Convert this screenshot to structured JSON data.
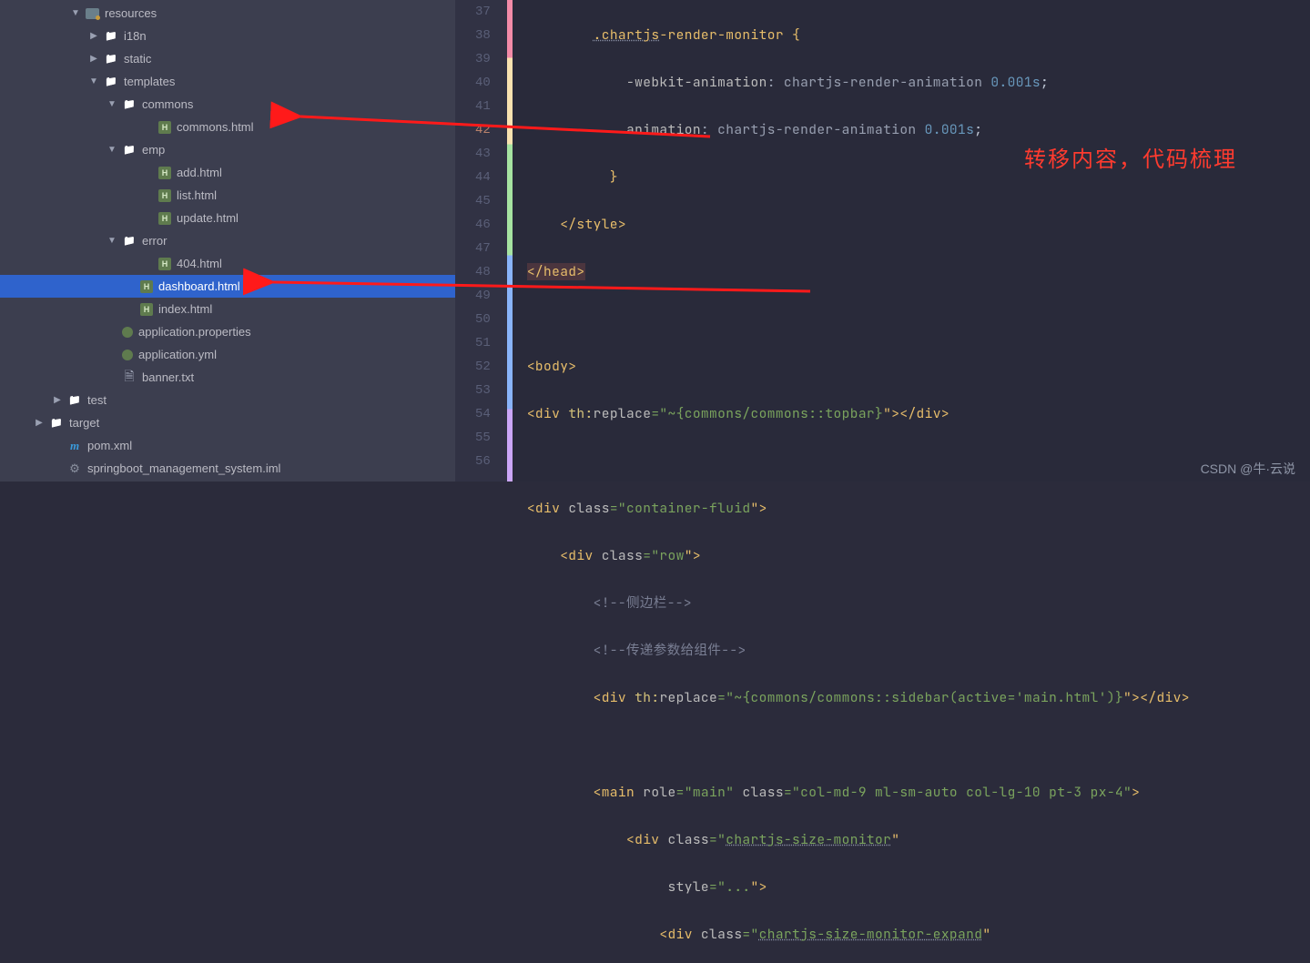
{
  "tree": [
    {
      "id": "resources",
      "indent": 76,
      "arrow": "down",
      "icon": "resfolder",
      "label": "resources"
    },
    {
      "id": "i18n",
      "indent": 96,
      "arrow": "right",
      "icon": "folder",
      "label": "i18n"
    },
    {
      "id": "static",
      "indent": 96,
      "arrow": "right",
      "icon": "folder",
      "label": "static"
    },
    {
      "id": "templates",
      "indent": 96,
      "arrow": "down",
      "icon": "folder",
      "label": "templates"
    },
    {
      "id": "commons",
      "indent": 116,
      "arrow": "down",
      "icon": "folder",
      "label": "commons"
    },
    {
      "id": "commons-html",
      "indent": 156,
      "arrow": "none",
      "icon": "html",
      "label": "commons.html"
    },
    {
      "id": "emp",
      "indent": 116,
      "arrow": "down",
      "icon": "folder",
      "label": "emp"
    },
    {
      "id": "add-html",
      "indent": 156,
      "arrow": "none",
      "icon": "html",
      "label": "add.html"
    },
    {
      "id": "list-html",
      "indent": 156,
      "arrow": "none",
      "icon": "html",
      "label": "list.html"
    },
    {
      "id": "update-html",
      "indent": 156,
      "arrow": "none",
      "icon": "html",
      "label": "update.html"
    },
    {
      "id": "error",
      "indent": 116,
      "arrow": "down",
      "icon": "folder",
      "label": "error"
    },
    {
      "id": "404-html",
      "indent": 156,
      "arrow": "none",
      "icon": "html",
      "label": "404.html"
    },
    {
      "id": "dashboard-html",
      "indent": 136,
      "arrow": "none",
      "icon": "html",
      "label": "dashboard.html",
      "selected": true
    },
    {
      "id": "index-html",
      "indent": 136,
      "arrow": "none",
      "icon": "html",
      "label": "index.html"
    },
    {
      "id": "app-props",
      "indent": 116,
      "arrow": "none",
      "icon": "props",
      "label": "application.properties"
    },
    {
      "id": "app-yml",
      "indent": 116,
      "arrow": "none",
      "icon": "yml",
      "label": "application.yml"
    },
    {
      "id": "banner-txt",
      "indent": 116,
      "arrow": "none",
      "icon": "txt",
      "label": "banner.txt"
    },
    {
      "id": "test",
      "indent": 56,
      "arrow": "right",
      "icon": "folder",
      "label": "test"
    },
    {
      "id": "target",
      "indent": 36,
      "arrow": "right",
      "icon": "folder",
      "label": "target"
    },
    {
      "id": "pom-xml",
      "indent": 56,
      "arrow": "none",
      "icon": "pom",
      "label": "pom.xml"
    },
    {
      "id": "iml",
      "indent": 56,
      "arrow": "none",
      "icon": "iml",
      "label": "springboot_management_system.iml"
    }
  ],
  "gutter": {
    "start": 37,
    "count": 20,
    "err_lines": [
      42
    ]
  },
  "code": {
    "l37_sel": ".chartjs",
    "l37_after": "-render-monitor {",
    "l38_prop": "-webkit-animation",
    "l38_val": ": chartjs-render-animation ",
    "l38_num": "0.001s",
    "l38_end": ";",
    "l39_prop": "animation",
    "l39_val": ": chartjs-render-animation ",
    "l39_num": "0.001s",
    "l39_end": ";",
    "l40": "          }",
    "l41": "    </style>",
    "l42": "</head>",
    "l44": "<body>",
    "l45_pre": "<div ",
    "l45_ns": "th:",
    "l45_attr": "replace",
    "l45_eq": "=\"",
    "l45_val": "~{commons/commons::topbar}",
    "l45_post": "\"></div>",
    "l47_pre": "<div ",
    "l47_attr": "class",
    "l47_eq": "=\"",
    "l47_val": "container-fluid",
    "l47_post": "\">",
    "l48_pre": "    <div ",
    "l48_attr": "class",
    "l48_eq": "=\"",
    "l48_val": "row",
    "l48_post": "\">",
    "l49": "        <!--侧边栏-->",
    "l50": "        <!--传递参数给组件-->",
    "l51_pre": "        <div ",
    "l51_ns": "th:",
    "l51_attr": "replace",
    "l51_eq": "=\"",
    "l51_val": "~{commons/commons::sidebar(active='main.html')}",
    "l51_post": "\"></div>",
    "l53_pre": "        <main ",
    "l53_a1": "role",
    "l53_v1": "=\"main\" ",
    "l53_a2": "class",
    "l53_v2": "=\"col-md-9 ml-sm-auto col-lg-10 pt-3 px-4\"",
    "l53_post": ">",
    "l54_pre": "            <div ",
    "l54_attr": "class",
    "l54_eq": "=\"",
    "l54_val": "chartjs-size-monitor",
    "l54_post": "\"",
    "l55_pre": "                 ",
    "l55_attr": "style",
    "l55_eq": "=\"",
    "l55_val": "...",
    "l55_post": "\">",
    "l56_pre": "                <div ",
    "l56_attr": "class",
    "l56_eq": "=\"",
    "l56_val": "chartjs-size-monitor-expand",
    "l56_post": "\""
  },
  "annotation": "转移内容，代码梳理",
  "watermark": "CSDN @牛·云说"
}
